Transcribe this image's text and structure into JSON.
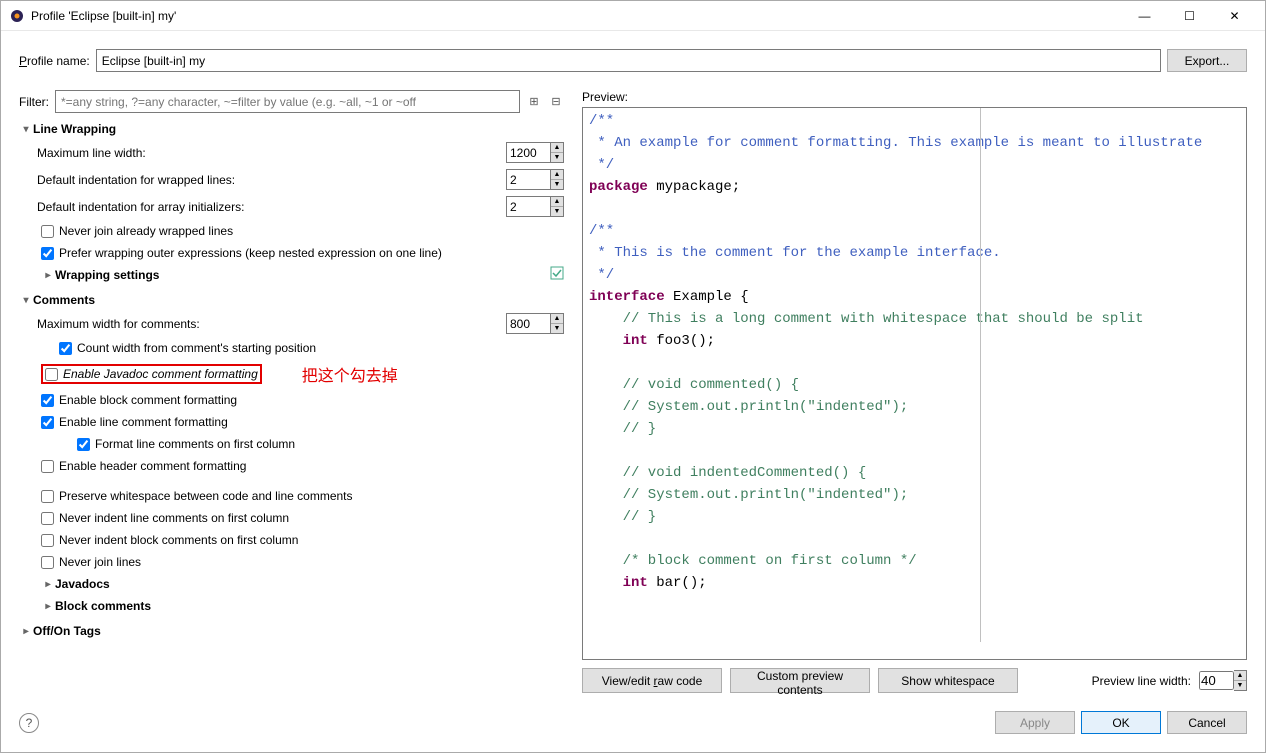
{
  "window": {
    "title": "Profile 'Eclipse [built-in] my'"
  },
  "profile": {
    "label": "Profile name:",
    "label_u": "P",
    "value": "Eclipse [built-in] my",
    "export": "Export..."
  },
  "filter": {
    "label": "Filter:",
    "placeholder": "*=any string, ?=any character, ~=filter by value (e.g. ~all, ~1 or ~off"
  },
  "sections": {
    "lineWrapping": {
      "title": "Line Wrapping",
      "maxWidth": {
        "label": "Maximum line width:",
        "value": "1200"
      },
      "defIndentWrapped": {
        "label": "Default indentation for wrapped lines:",
        "value": "2"
      },
      "defIndentArray": {
        "label": "Default indentation for array initializers:",
        "value": "2"
      },
      "neverJoin": {
        "label": "Never join already wrapped lines",
        "checked": false
      },
      "preferWrap": {
        "label": "Prefer wrapping outer expressions (keep nested expression on one line)",
        "checked": true
      },
      "wrappingSettings": "Wrapping settings"
    },
    "comments": {
      "title": "Comments",
      "maxWidth": {
        "label": "Maximum width for comments:",
        "value": "800"
      },
      "countWidth": {
        "label": "Count width from comment's starting position",
        "checked": true
      },
      "enableJavadoc": {
        "label": "Enable Javadoc comment formatting",
        "checked": false
      },
      "enableBlock": {
        "label": "Enable block comment formatting",
        "checked": true
      },
      "enableLine": {
        "label": "Enable line comment formatting",
        "checked": true
      },
      "formatFirstCol": {
        "label": "Format line comments on first column",
        "checked": true
      },
      "enableHeader": {
        "label": "Enable header comment formatting",
        "checked": false
      },
      "preserveWs": {
        "label": "Preserve whitespace between code and line comments",
        "checked": false
      },
      "neverIndentLine": {
        "label": "Never indent line comments on first column",
        "checked": false
      },
      "neverIndentBlock": {
        "label": "Never indent block comments on first column",
        "checked": false
      },
      "neverJoinLines": {
        "label": "Never join lines",
        "checked": false
      },
      "javadocs": "Javadocs",
      "blockComments": "Block comments"
    },
    "offOn": {
      "title": "Off/On Tags"
    }
  },
  "annotation": "把这个勾去掉",
  "preview": {
    "label": "Preview:",
    "viewEdit": "View/edit raw code",
    "viewEdit_u": "r",
    "custom": "Custom preview contents",
    "whitespace": "Show whitespace",
    "lineWidth": {
      "label": "Preview line width:",
      "value": "40"
    }
  },
  "code": {
    "l1": "/**",
    "l2": " * An example for comment formatting. This example is meant to illustrate",
    "l3": " */",
    "l4a": "package",
    "l4b": " mypackage;",
    "l6": "/**",
    "l7": " * This is the comment for the example interface.",
    "l8": " */",
    "l9a": "interface",
    "l9b": " Example {",
    "l10": "    // This is a long comment with whitespace that should be split",
    "l11a": "    ",
    "l11b": "int",
    "l11c": " foo3();",
    "l13": "    // void commented() {",
    "l14": "    // System.out.println(\"indented\");",
    "l15": "    // }",
    "l17": "    // void indentedCommented() {",
    "l18": "    // System.out.println(\"indented\");",
    "l19": "    // }",
    "l21": "    /* block comment on first column */",
    "l22a": "    ",
    "l22b": "int",
    "l22c": " bar();"
  },
  "footer": {
    "apply": "Apply",
    "ok": "OK",
    "cancel": "Cancel"
  }
}
